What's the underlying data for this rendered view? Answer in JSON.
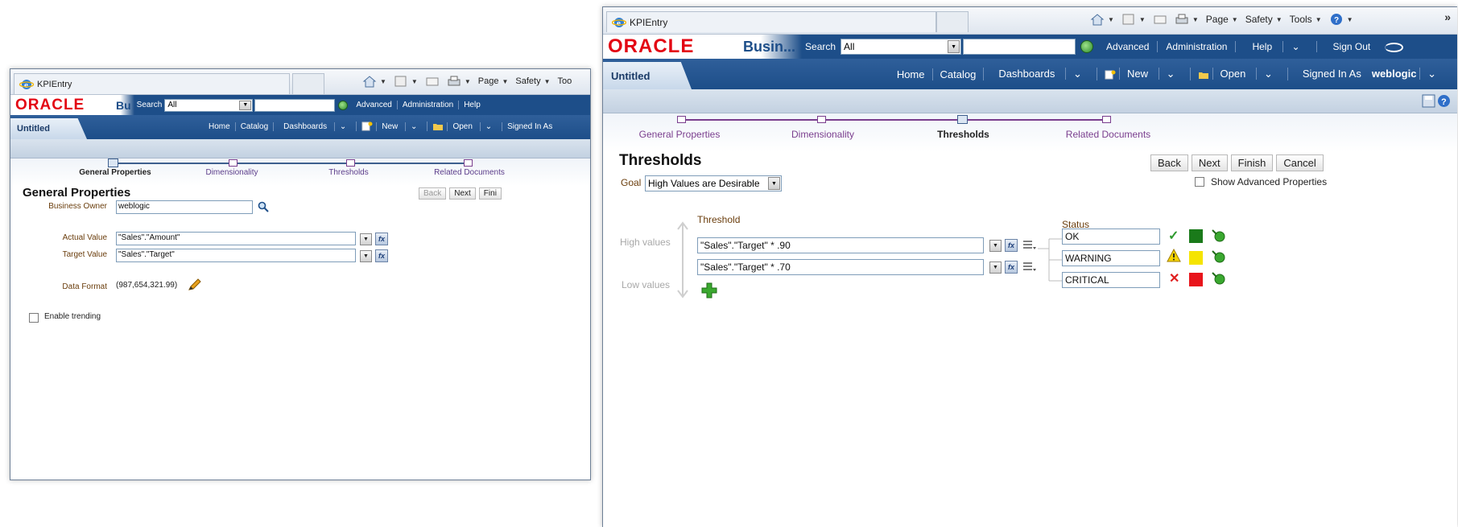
{
  "left": {
    "browser": {
      "tab_title": "KPIEntry",
      "cmd": [
        "Page",
        "Safety",
        "Too"
      ]
    },
    "global": {
      "brand": "ORACLE",
      "product": "Bu",
      "search_label": "Search",
      "search_scope": "All",
      "links": [
        "Advanced",
        "Administration",
        "Help"
      ]
    },
    "nav": {
      "tab": "Untitled",
      "links": [
        "Home",
        "Catalog",
        "Dashboards",
        "New",
        "Open",
        "Signed In As"
      ]
    },
    "train": [
      "General Properties",
      "Dimensionality",
      "Thresholds",
      "Related Documents"
    ],
    "page_title": "General Properties",
    "buttons": [
      "Back",
      "Next",
      "Fini"
    ],
    "fields": {
      "business_owner_label": "Business Owner",
      "business_owner": "weblogic",
      "actual_label": "Actual Value",
      "actual": "\"Sales\".\"Amount\"",
      "target_label": "Target Value",
      "target": "\"Sales\".\"Target\"",
      "format_label": "Data Format",
      "format": "(987,654,321.99)",
      "trending_label": "Enable trending"
    }
  },
  "right": {
    "browser": {
      "tab_title": "KPIEntry",
      "cmd": [
        "Page",
        "Safety",
        "Tools"
      ]
    },
    "global": {
      "brand": "ORACLE",
      "product": "Busin...",
      "search_label": "Search",
      "search_scope": "All",
      "links": [
        "Advanced",
        "Administration",
        "Help",
        "Sign Out"
      ]
    },
    "nav": {
      "tab": "Untitled",
      "links": [
        "Home",
        "Catalog",
        "Dashboards",
        "New",
        "Open",
        "Signed In As"
      ],
      "user": "weblogic"
    },
    "train": [
      "General Properties",
      "Dimensionality",
      "Thresholds",
      "Related Documents"
    ],
    "page_title": "Thresholds",
    "buttons": [
      "Back",
      "Next",
      "Finish",
      "Cancel"
    ],
    "goal_label": "Goal",
    "goal_value": "High Values are Desirable",
    "show_advanced": "Show Advanced Properties",
    "threshold_header": "Threshold",
    "status_header": "Status",
    "high_values": "High values",
    "low_values": "Low values",
    "thresholds": [
      "\"Sales\".\"Target\" * .90",
      "\"Sales\".\"Target\" * .70"
    ],
    "statuses": [
      {
        "label": "OK",
        "color": "#1a7a1a",
        "icon": "check-icon"
      },
      {
        "label": "WARNING",
        "color": "#f5e400",
        "icon": "warning-icon"
      },
      {
        "label": "CRITICAL",
        "color": "#e8141b",
        "icon": "x-icon"
      }
    ]
  }
}
